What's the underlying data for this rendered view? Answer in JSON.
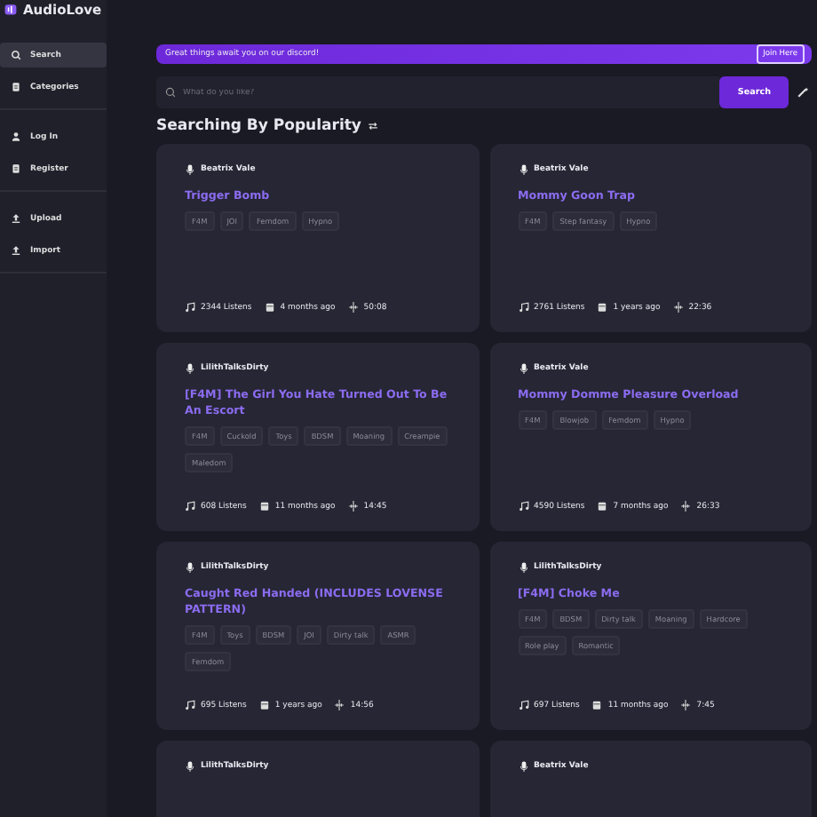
{
  "app": {
    "name": "AudioLove"
  },
  "sidebar": {
    "groups": [
      [
        {
          "label": "Search",
          "kind": "search",
          "selected": true
        },
        {
          "label": "Categories",
          "kind": "list",
          "selected": false
        }
      ],
      [
        {
          "label": "Log In",
          "kind": "user",
          "selected": false
        },
        {
          "label": "Register",
          "kind": "list",
          "selected": false
        }
      ],
      [
        {
          "label": "Upload",
          "kind": "upload",
          "selected": false
        },
        {
          "label": "Import",
          "kind": "upload",
          "selected": false
        }
      ]
    ]
  },
  "banner": {
    "text": "Great things await you on our discord!",
    "button": "Join Here"
  },
  "search": {
    "placeholder": "What do you like?",
    "button": "Search"
  },
  "heading": "Searching By Popularity",
  "cards": [
    {
      "author": "Beatrix Vale",
      "title": "Trigger Bomb",
      "tags": [
        "F4M",
        "JOI",
        "Femdom",
        "Hypno"
      ],
      "listens": "2344 Listens",
      "age": "4 months ago",
      "duration": "50:08"
    },
    {
      "author": "Beatrix Vale",
      "title": "Mommy Goon Trap",
      "tags": [
        "F4M",
        "Step fantasy",
        "Hypno"
      ],
      "listens": "2761 Listens",
      "age": "1 years ago",
      "duration": "22:36"
    },
    {
      "author": "LilithTalksDirty",
      "title": "[F4M] The Girl You Hate Turned Out To Be An Escort",
      "tags": [
        "F4M",
        "Cuckold",
        "Toys",
        "BDSM",
        "Moaning",
        "Creampie",
        "Maledom"
      ],
      "listens": "608 Listens",
      "age": "11 months ago",
      "duration": "14:45"
    },
    {
      "author": "Beatrix Vale",
      "title": "Mommy Domme Pleasure Overload",
      "tags": [
        "F4M",
        "Blowjob",
        "Femdom",
        "Hypno"
      ],
      "listens": "4590 Listens",
      "age": "7 months ago",
      "duration": "26:33"
    },
    {
      "author": "LilithTalksDirty",
      "title": "Caught Red Handed (INCLUDES LOVENSE PATTERN)",
      "tags": [
        "F4M",
        "Toys",
        "BDSM",
        "JOI",
        "Dirty talk",
        "ASMR",
        "Femdom"
      ],
      "listens": "695 Listens",
      "age": "1 years ago",
      "duration": "14:56"
    },
    {
      "author": "LilithTalksDirty",
      "title": "[F4M] Choke Me",
      "tags": [
        "F4M",
        "BDSM",
        "Dirty talk",
        "Moaning",
        "Hardcore",
        "Role play",
        "Romantic"
      ],
      "listens": "697 Listens",
      "age": "11 months ago",
      "duration": "7:45"
    },
    {
      "author": "LilithTalksDirty"
    },
    {
      "author": "Beatrix Vale"
    }
  ]
}
